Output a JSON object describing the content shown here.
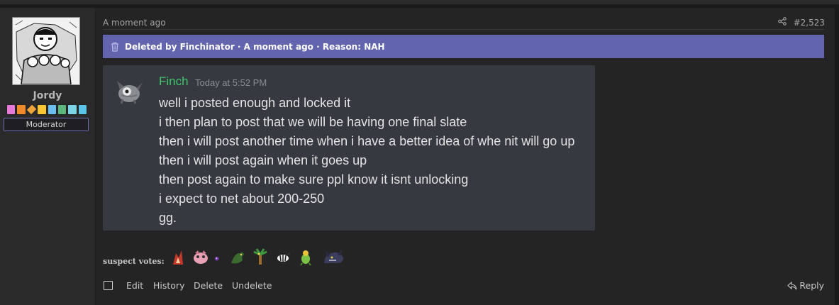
{
  "user": {
    "name": "Jordy",
    "role": "Moderator",
    "badge_colors": [
      "#e77ad9",
      "#ef8a2b",
      "#f0a53a",
      "#f7c531",
      "#6bbdf0",
      "#5bb77b",
      "#7dd4e6",
      "#59c3e8"
    ]
  },
  "post": {
    "timestamp": "A moment ago",
    "number": "#2,523",
    "deleted_notice": "Deleted by Finchinator · A moment ago · Reason: NAH"
  },
  "chat": {
    "author": "Finch",
    "time": "Today at 5:52 PM",
    "lines": [
      "well i posted enough and locked it",
      "i then plan to post that we will be having one final slate",
      "then i will post another time when i have a better idea of whe nit will go up",
      "then i will post again when it goes up",
      "then post again to make sure ppl know it isnt unlocking",
      "i expect to net about 200-250",
      "gg."
    ]
  },
  "signature": {
    "label": "suspect votes:",
    "sprites": [
      "fire-pokemon-icon",
      "pink-pokemon-icon",
      "orb-icon",
      "green-dragon-icon",
      "palm-tree-pokemon-icon",
      "zebra-pokemon-icon",
      "green-flower-pokemon-icon",
      "dark-beast-pokemon-icon"
    ]
  },
  "actions": {
    "edit": "Edit",
    "history": "History",
    "delete": "Delete",
    "undelete": "Undelete",
    "reply": "Reply"
  }
}
